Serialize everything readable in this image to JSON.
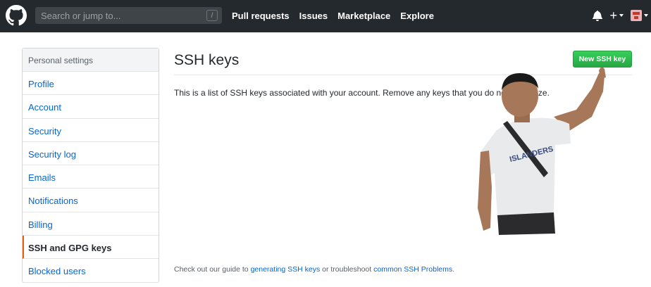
{
  "header": {
    "search_placeholder": "Search or jump to...",
    "search_shortcut": "/",
    "nav": [
      "Pull requests",
      "Issues",
      "Marketplace",
      "Explore"
    ],
    "plus_symbol": "+"
  },
  "sidebar": {
    "heading": "Personal settings",
    "items": [
      {
        "label": "Profile"
      },
      {
        "label": "Account"
      },
      {
        "label": "Security"
      },
      {
        "label": "Security log"
      },
      {
        "label": "Emails"
      },
      {
        "label": "Notifications"
      },
      {
        "label": "Billing"
      },
      {
        "label": "SSH and GPG keys",
        "active": true
      },
      {
        "label": "Blocked users"
      }
    ]
  },
  "main": {
    "title": "SSH keys",
    "new_key_button": "New SSH key",
    "description": "This is a list of SSH keys associated with your account. Remove any keys that you do not recognize.",
    "footer": {
      "prefix": "Check out our guide to ",
      "link1": "generating SSH keys",
      "middle": " or troubleshoot ",
      "link2": "common SSH Problems",
      "suffix": "."
    },
    "shirt_text": "ISLANDERS"
  },
  "colors": {
    "header_bg": "#24292e",
    "link": "#0366d6",
    "button_green": "#28a745",
    "active_border": "#e36209"
  }
}
